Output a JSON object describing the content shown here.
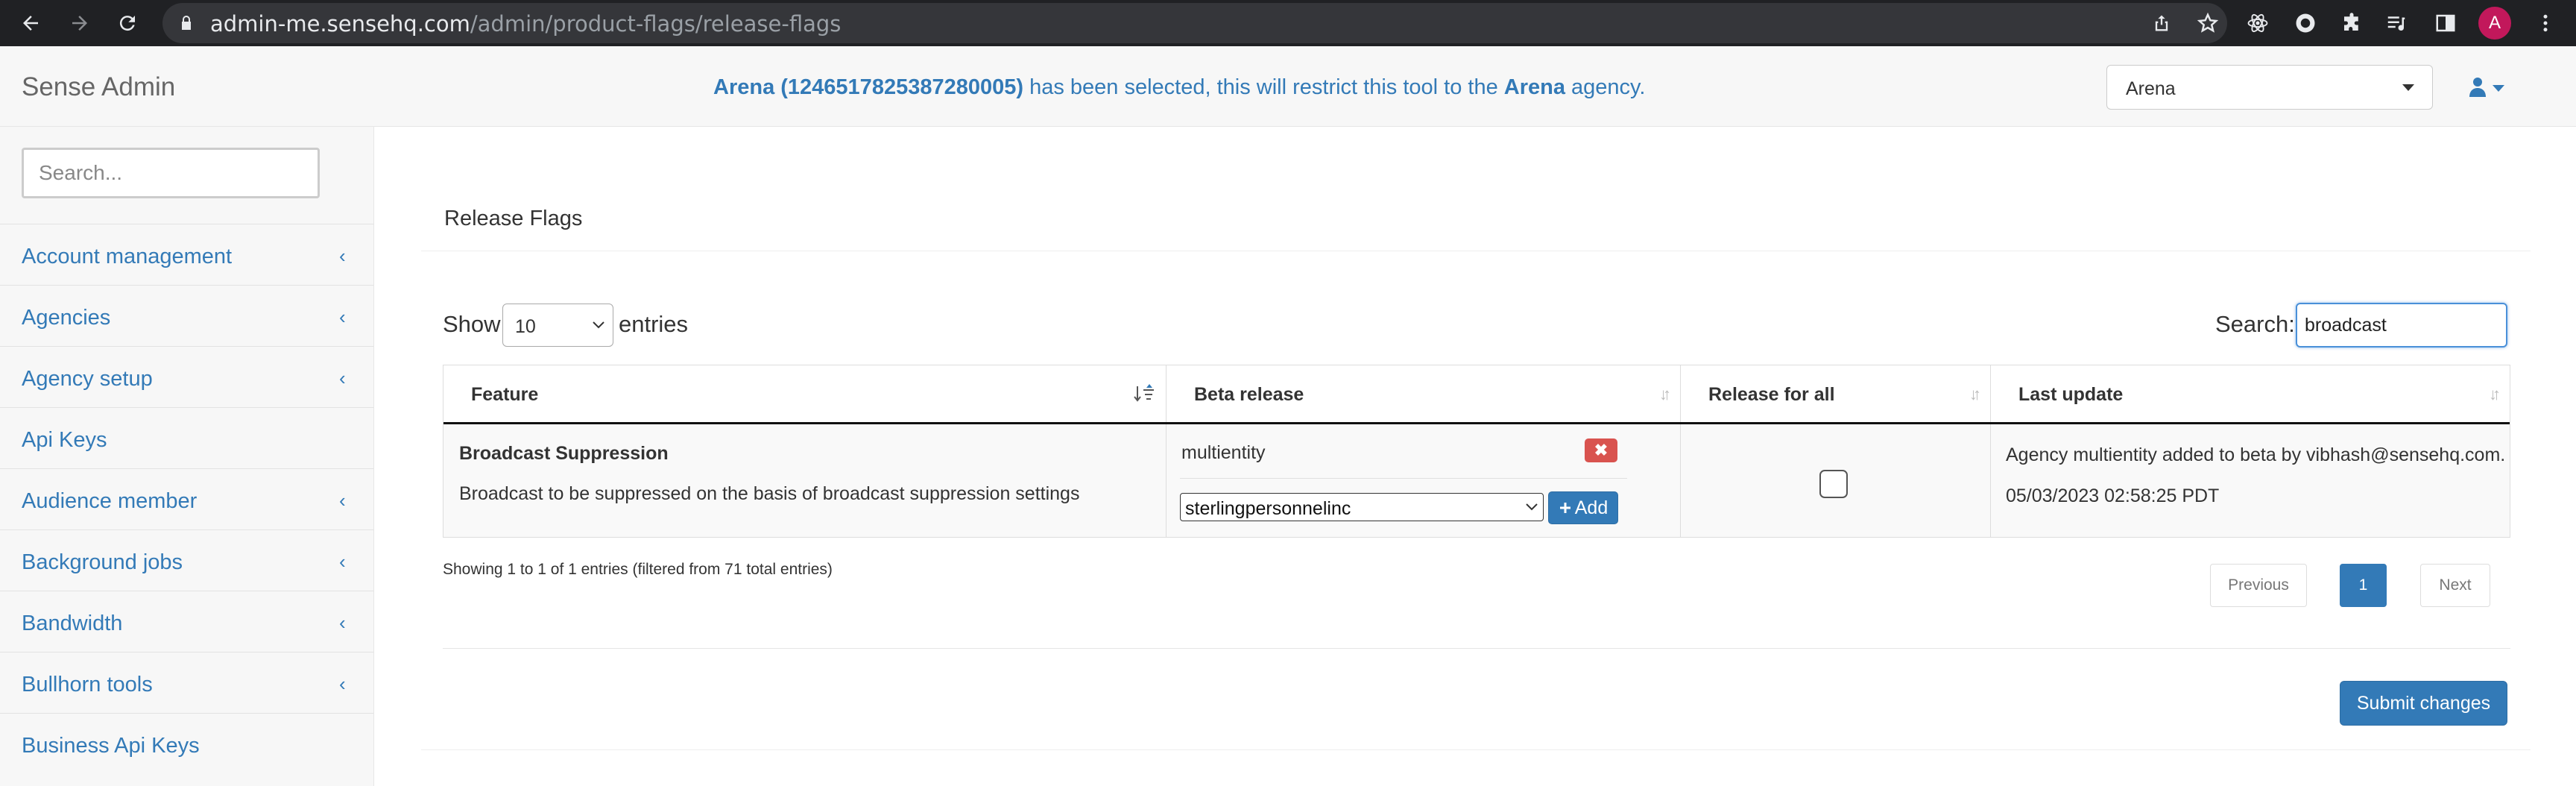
{
  "browser": {
    "url_host": "admin-me.sensehq.com",
    "url_path": "/admin/product-flags/release-flags",
    "profile_initial": "A"
  },
  "header": {
    "brand": "Sense Admin",
    "notice_agency": "Arena (1246517825387280005)",
    "notice_middle": " has been selected, this will restrict this tool to the ",
    "notice_agency_short": "Arena",
    "notice_end": " agency.",
    "agency_select_value": "Arena"
  },
  "sidebar": {
    "search_placeholder": "Search...",
    "items": [
      {
        "label": "Account management",
        "chevron": "‹"
      },
      {
        "label": "Agencies",
        "chevron": "‹"
      },
      {
        "label": "Agency setup",
        "chevron": "‹"
      },
      {
        "label": "Api Keys",
        "chevron": ""
      },
      {
        "label": "Audience member",
        "chevron": "‹"
      },
      {
        "label": "Background jobs",
        "chevron": "‹"
      },
      {
        "label": "Bandwidth",
        "chevron": "‹"
      },
      {
        "label": "Bullhorn tools",
        "chevron": "‹"
      },
      {
        "label": "Business Api Keys",
        "chevron": ""
      }
    ]
  },
  "main": {
    "panel_title": "Release Flags",
    "show_label": "Show",
    "length_value": "10",
    "entries_label": "entries",
    "search_label": "Search:",
    "search_value": "broadcast",
    "table": {
      "headers": [
        "Feature",
        "Beta release",
        "Release for all",
        "Last update"
      ],
      "row": {
        "feature_name": "Broadcast Suppression",
        "feature_desc": "Broadcast to be suppressed on the basis of broadcast suppression settings",
        "beta_agency": "multientity",
        "remove_label": "✖",
        "agency_pick_value": "sterlingpersonnelinc",
        "add_label": "Add",
        "release_for_all": false,
        "last_update_text": "Agency multientity added to beta by vibhash@sensehq.com.",
        "last_update_time": "05/03/2023 02:58:25 PDT"
      }
    },
    "info": "Showing 1 to 1 of 1 entries (filtered from 71 total entries)",
    "pagination": {
      "previous": "Previous",
      "current": "1",
      "next": "Next"
    },
    "submit_label": "Submit changes"
  },
  "colors": {
    "link": "#337ab7",
    "danger": "#d9534f",
    "chrome": "#202124"
  }
}
